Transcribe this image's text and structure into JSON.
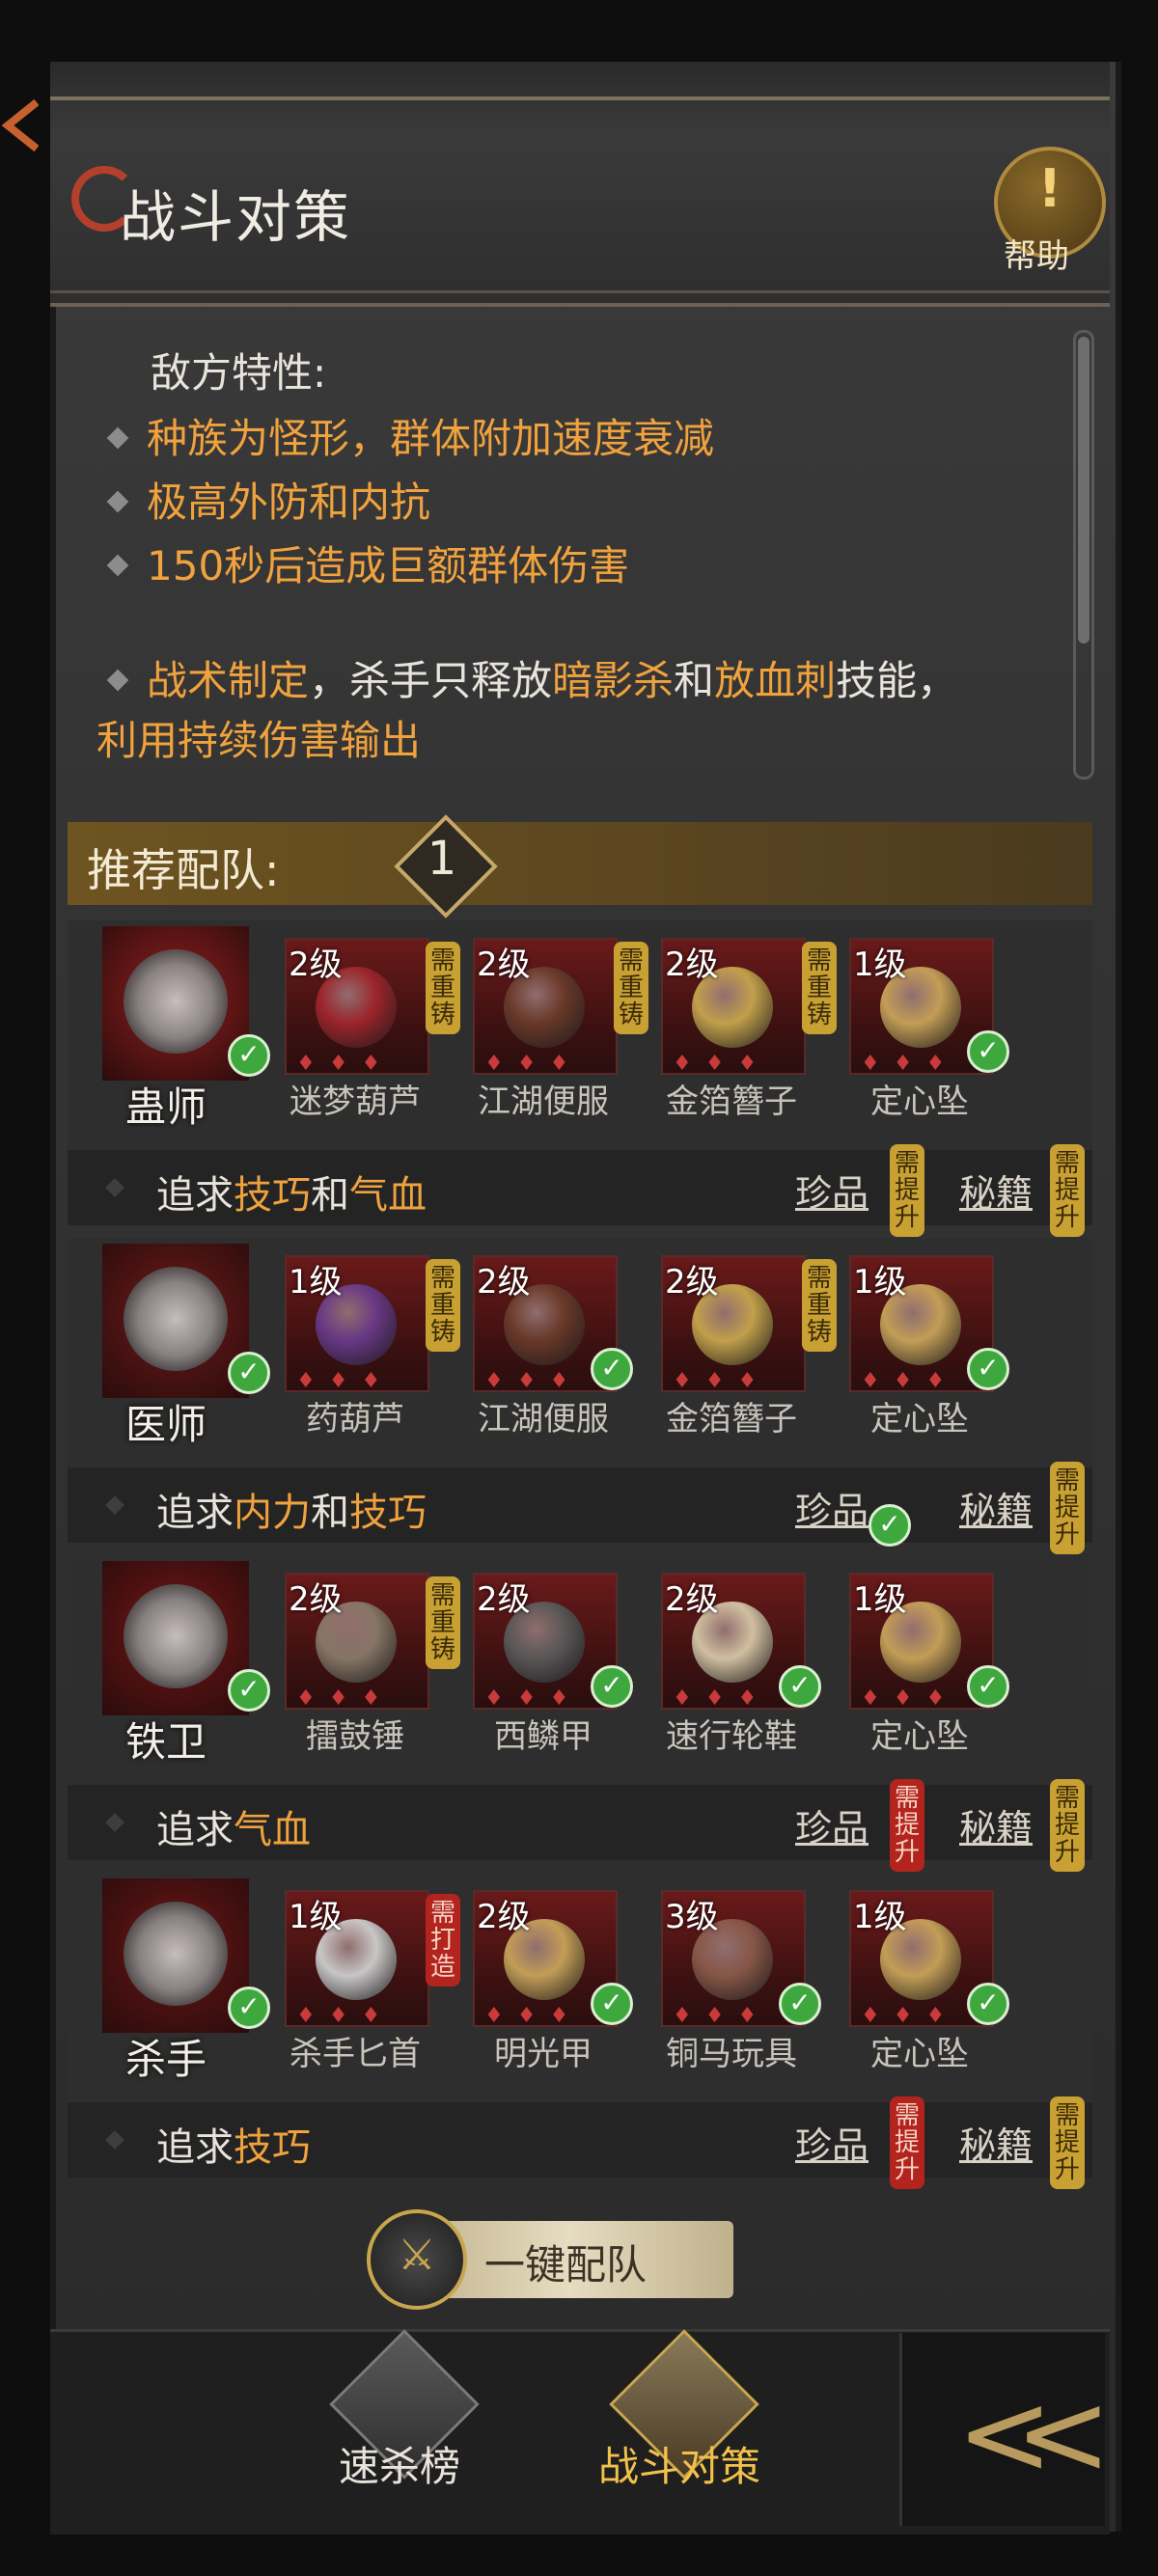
{
  "header": {
    "title": "战斗对策",
    "help_label": "帮助",
    "help_mark": "!"
  },
  "traits": {
    "heading": "敌方特性:",
    "items": [
      "种族为怪形，群体附加速度衰减",
      "极高外防和内抗",
      "150秒后造成巨额群体伤害"
    ],
    "tactic": {
      "parts": [
        "战术制定",
        "，杀手只释放",
        "暗影杀",
        "和",
        "放血刺",
        "技能，",
        "利用持续伤害输出"
      ]
    }
  },
  "recommend": {
    "title": "推荐配队:",
    "badge": "1"
  },
  "roles": [
    {
      "name": "蛊师",
      "items": [
        {
          "level": "2级",
          "name": "迷梦葫芦",
          "tag": "需重铸",
          "tag_color": "gold",
          "checked": false
        },
        {
          "level": "2级",
          "name": "江湖便服",
          "tag": "需重铸",
          "tag_color": "gold",
          "checked": false
        },
        {
          "level": "2级",
          "name": "金箔簪子",
          "tag": "需重铸",
          "tag_color": "gold",
          "checked": false
        },
        {
          "level": "1级",
          "name": "定心坠",
          "tag": "",
          "tag_color": "",
          "checked": true
        }
      ],
      "pursue": {
        "prefix": "追求",
        "a": "技巧",
        "mid": "和",
        "b": "气血"
      },
      "treasure": {
        "label": "珍品",
        "tag": "需提升",
        "tag_color": "gold",
        "checked": false
      },
      "manual": {
        "label": "秘籍",
        "tag": "需提升",
        "tag_color": "gold",
        "checked": false
      }
    },
    {
      "name": "医师",
      "items": [
        {
          "level": "1级",
          "name": "药葫芦",
          "tag": "需重铸",
          "tag_color": "gold",
          "checked": false
        },
        {
          "level": "2级",
          "name": "江湖便服",
          "tag": "",
          "tag_color": "",
          "checked": true
        },
        {
          "level": "2级",
          "name": "金箔簪子",
          "tag": "需重铸",
          "tag_color": "gold",
          "checked": false
        },
        {
          "level": "1级",
          "name": "定心坠",
          "tag": "",
          "tag_color": "",
          "checked": true
        }
      ],
      "pursue": {
        "prefix": "追求",
        "a": "内力",
        "mid": "和",
        "b": "技巧"
      },
      "treasure": {
        "label": "珍品",
        "tag": "",
        "tag_color": "",
        "checked": true
      },
      "manual": {
        "label": "秘籍",
        "tag": "需提升",
        "tag_color": "gold",
        "checked": false
      }
    },
    {
      "name": "铁卫",
      "items": [
        {
          "level": "2级",
          "name": "擂鼓锤",
          "tag": "需重铸",
          "tag_color": "gold",
          "checked": false
        },
        {
          "level": "2级",
          "name": "西鳞甲",
          "tag": "",
          "tag_color": "",
          "checked": true
        },
        {
          "level": "2级",
          "name": "速行轮鞋",
          "tag": "",
          "tag_color": "",
          "checked": true
        },
        {
          "level": "1级",
          "name": "定心坠",
          "tag": "",
          "tag_color": "",
          "checked": true
        }
      ],
      "pursue": {
        "prefix": "追求",
        "a": "气血",
        "mid": "",
        "b": ""
      },
      "treasure": {
        "label": "珍品",
        "tag": "需提升",
        "tag_color": "red",
        "checked": false
      },
      "manual": {
        "label": "秘籍",
        "tag": "需提升",
        "tag_color": "gold",
        "checked": false
      }
    },
    {
      "name": "杀手",
      "items": [
        {
          "level": "1级",
          "name": "杀手匕首",
          "tag": "需打造",
          "tag_color": "red",
          "checked": false
        },
        {
          "level": "2级",
          "name": "明光甲",
          "tag": "",
          "tag_color": "",
          "checked": true
        },
        {
          "level": "3级",
          "name": "铜马玩具",
          "tag": "",
          "tag_color": "",
          "checked": true
        },
        {
          "level": "1级",
          "name": "定心坠",
          "tag": "",
          "tag_color": "",
          "checked": true
        }
      ],
      "pursue": {
        "prefix": "追求",
        "a": "技巧",
        "mid": "",
        "b": ""
      },
      "treasure": {
        "label": "珍品",
        "tag": "需提升",
        "tag_color": "red",
        "checked": false
      },
      "manual": {
        "label": "秘籍",
        "tag": "需提升",
        "tag_color": "gold",
        "checked": false
      }
    }
  ],
  "one_key": {
    "label": "一键配队"
  },
  "bottom_nav": {
    "tabs": [
      "速杀榜",
      "战斗对策"
    ],
    "active": 1
  },
  "colors": {
    "accent": "#f0a23e",
    "gold_tag": "#c9a133",
    "red_tag": "#b3241e",
    "check": "#3ea83e"
  }
}
